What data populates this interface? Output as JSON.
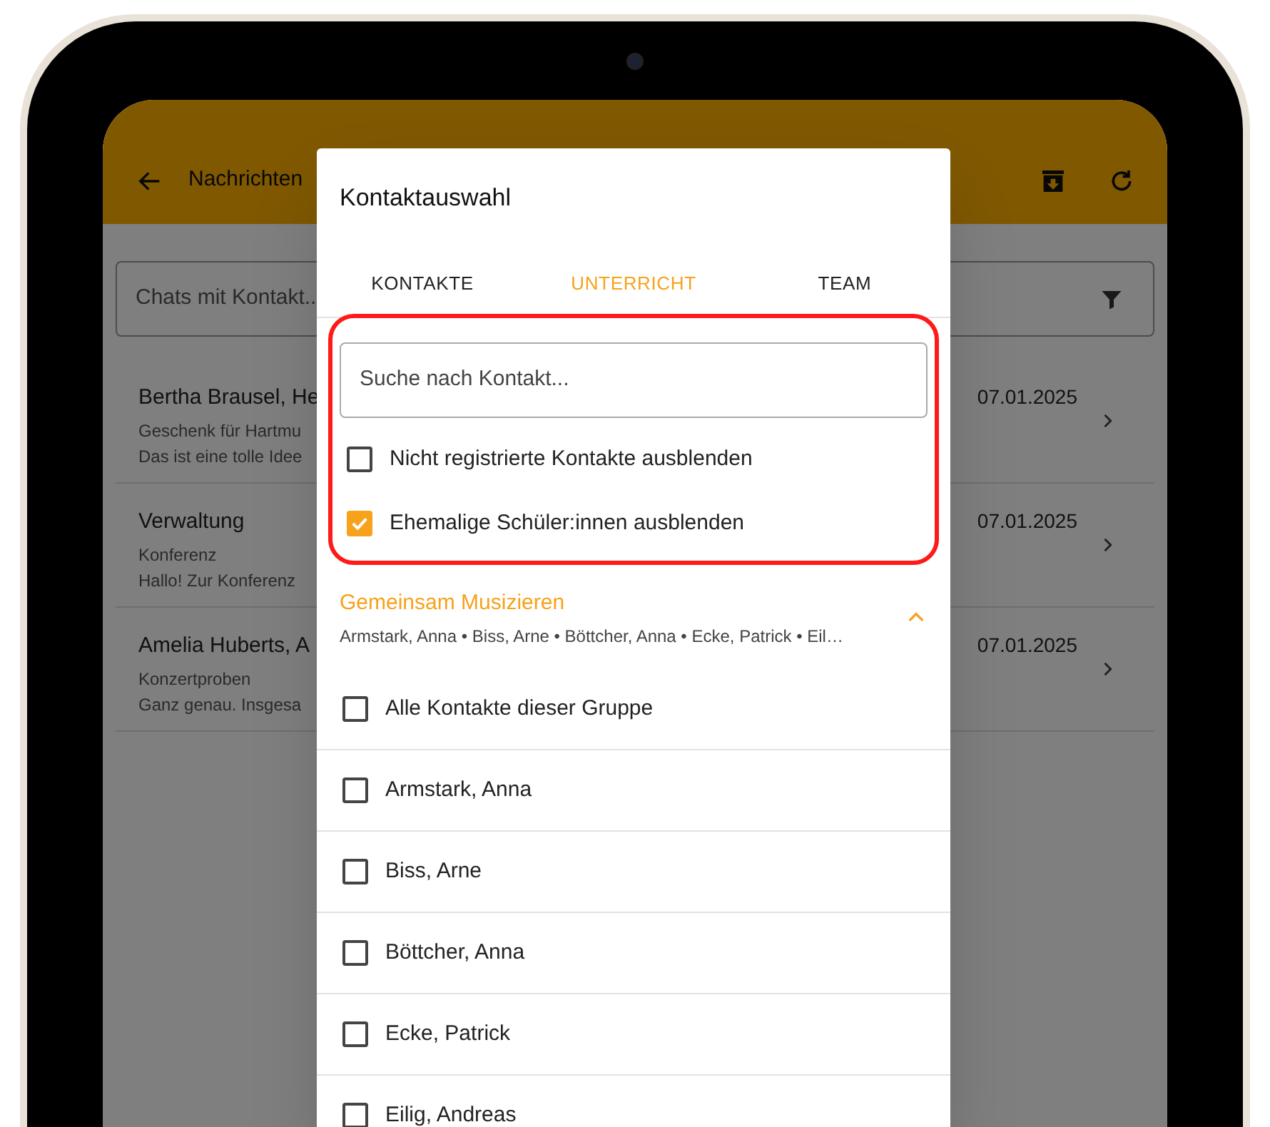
{
  "app_bar": {
    "title": "Nachrichten"
  },
  "chat_search": {
    "placeholder": "Chats mit Kontakt.."
  },
  "chats": [
    {
      "title": "Bertha Brausel, He",
      "subject": "Geschenk für Hartmu",
      "preview": "Das ist eine tolle Idee",
      "date": "07.01.2025"
    },
    {
      "title": "Verwaltung",
      "subject": "Konferenz",
      "preview": "Hallo! Zur Konferenz",
      "date": "07.01.2025"
    },
    {
      "title": "Amelia Huberts, A",
      "subject": "Konzertproben",
      "preview": "Ganz genau. Insgesa",
      "date": "07.01.2025"
    }
  ],
  "dialog": {
    "title": "Kontaktauswahl",
    "tabs": [
      {
        "label": "KONTAKTE",
        "selected": false
      },
      {
        "label": "UNTERRICHT",
        "selected": true
      },
      {
        "label": "TEAM",
        "selected": false
      }
    ],
    "search": {
      "placeholder": "Suche nach Kontakt..."
    },
    "filters": [
      {
        "label": "Nicht registrierte Kontakte ausblenden",
        "checked": false
      },
      {
        "label": "Ehemalige Schüler:innen ausblenden",
        "checked": true
      }
    ],
    "group": {
      "title": "Gemeinsam Musizieren",
      "members": "Armstark, Anna • Biss, Arne • Böttcher, Anna • Ecke, Patrick • Eil…",
      "expanded": true
    },
    "contacts": [
      {
        "label": "Alle Kontakte dieser Gruppe",
        "checked": false
      },
      {
        "label": "Armstark, Anna",
        "checked": false
      },
      {
        "label": "Biss, Arne",
        "checked": false
      },
      {
        "label": "Böttcher, Anna",
        "checked": false
      },
      {
        "label": "Ecke, Patrick",
        "checked": false
      },
      {
        "label": "Eilig, Andreas",
        "checked": false
      }
    ]
  }
}
